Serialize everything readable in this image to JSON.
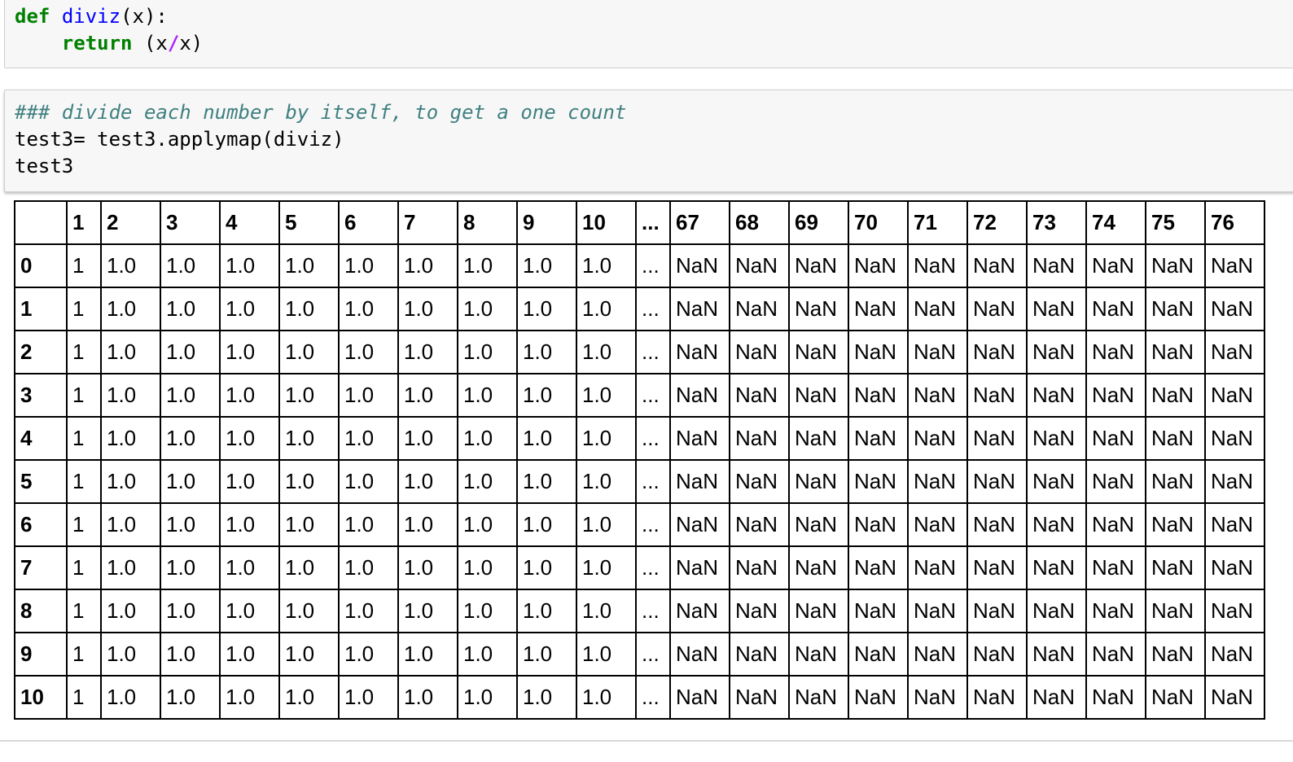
{
  "cells": [
    {
      "lines": [
        [
          {
            "t": "def",
            "c": "kw"
          },
          {
            "t": " "
          },
          {
            "t": "diviz",
            "c": "fn"
          },
          {
            "t": "(x):"
          }
        ],
        [
          {
            "t": "    "
          },
          {
            "t": "return",
            "c": "kw"
          },
          {
            "t": " (x"
          },
          {
            "t": "/",
            "c": "op"
          },
          {
            "t": "x)"
          }
        ]
      ]
    },
    {
      "lines": [
        [
          {
            "t": "### divide each number by itself, to get a one count",
            "c": "cm"
          }
        ],
        [
          {
            "t": "test3= test3.applymap(diviz)"
          }
        ],
        [
          {
            "t": "test3"
          }
        ]
      ]
    }
  ],
  "output": {
    "columns": [
      "",
      "1",
      "2",
      "3",
      "4",
      "5",
      "6",
      "7",
      "8",
      "9",
      "10",
      "...",
      "67",
      "68",
      "69",
      "70",
      "71",
      "72",
      "73",
      "74",
      "75",
      "76"
    ],
    "rows": [
      {
        "index": "0",
        "values": [
          "1",
          "1.0",
          "1.0",
          "1.0",
          "1.0",
          "1.0",
          "1.0",
          "1.0",
          "1.0",
          "1.0",
          "...",
          "NaN",
          "NaN",
          "NaN",
          "NaN",
          "NaN",
          "NaN",
          "NaN",
          "NaN",
          "NaN",
          "NaN"
        ]
      },
      {
        "index": "1",
        "values": [
          "1",
          "1.0",
          "1.0",
          "1.0",
          "1.0",
          "1.0",
          "1.0",
          "1.0",
          "1.0",
          "1.0",
          "...",
          "NaN",
          "NaN",
          "NaN",
          "NaN",
          "NaN",
          "NaN",
          "NaN",
          "NaN",
          "NaN",
          "NaN"
        ]
      },
      {
        "index": "2",
        "values": [
          "1",
          "1.0",
          "1.0",
          "1.0",
          "1.0",
          "1.0",
          "1.0",
          "1.0",
          "1.0",
          "1.0",
          "...",
          "NaN",
          "NaN",
          "NaN",
          "NaN",
          "NaN",
          "NaN",
          "NaN",
          "NaN",
          "NaN",
          "NaN"
        ]
      },
      {
        "index": "3",
        "values": [
          "1",
          "1.0",
          "1.0",
          "1.0",
          "1.0",
          "1.0",
          "1.0",
          "1.0",
          "1.0",
          "1.0",
          "...",
          "NaN",
          "NaN",
          "NaN",
          "NaN",
          "NaN",
          "NaN",
          "NaN",
          "NaN",
          "NaN",
          "NaN"
        ]
      },
      {
        "index": "4",
        "values": [
          "1",
          "1.0",
          "1.0",
          "1.0",
          "1.0",
          "1.0",
          "1.0",
          "1.0",
          "1.0",
          "1.0",
          "...",
          "NaN",
          "NaN",
          "NaN",
          "NaN",
          "NaN",
          "NaN",
          "NaN",
          "NaN",
          "NaN",
          "NaN"
        ]
      },
      {
        "index": "5",
        "values": [
          "1",
          "1.0",
          "1.0",
          "1.0",
          "1.0",
          "1.0",
          "1.0",
          "1.0",
          "1.0",
          "1.0",
          "...",
          "NaN",
          "NaN",
          "NaN",
          "NaN",
          "NaN",
          "NaN",
          "NaN",
          "NaN",
          "NaN",
          "NaN"
        ]
      },
      {
        "index": "6",
        "values": [
          "1",
          "1.0",
          "1.0",
          "1.0",
          "1.0",
          "1.0",
          "1.0",
          "1.0",
          "1.0",
          "1.0",
          "...",
          "NaN",
          "NaN",
          "NaN",
          "NaN",
          "NaN",
          "NaN",
          "NaN",
          "NaN",
          "NaN",
          "NaN"
        ]
      },
      {
        "index": "7",
        "values": [
          "1",
          "1.0",
          "1.0",
          "1.0",
          "1.0",
          "1.0",
          "1.0",
          "1.0",
          "1.0",
          "1.0",
          "...",
          "NaN",
          "NaN",
          "NaN",
          "NaN",
          "NaN",
          "NaN",
          "NaN",
          "NaN",
          "NaN",
          "NaN"
        ]
      },
      {
        "index": "8",
        "values": [
          "1",
          "1.0",
          "1.0",
          "1.0",
          "1.0",
          "1.0",
          "1.0",
          "1.0",
          "1.0",
          "1.0",
          "...",
          "NaN",
          "NaN",
          "NaN",
          "NaN",
          "NaN",
          "NaN",
          "NaN",
          "NaN",
          "NaN",
          "NaN"
        ]
      },
      {
        "index": "9",
        "values": [
          "1",
          "1.0",
          "1.0",
          "1.0",
          "1.0",
          "1.0",
          "1.0",
          "1.0",
          "1.0",
          "1.0",
          "...",
          "NaN",
          "NaN",
          "NaN",
          "NaN",
          "NaN",
          "NaN",
          "NaN",
          "NaN",
          "NaN",
          "NaN"
        ]
      },
      {
        "index": "10",
        "values": [
          "1",
          "1.0",
          "1.0",
          "1.0",
          "1.0",
          "1.0",
          "1.0",
          "1.0",
          "1.0",
          "1.0",
          "...",
          "NaN",
          "NaN",
          "NaN",
          "NaN",
          "NaN",
          "NaN",
          "NaN",
          "NaN",
          "NaN",
          "NaN"
        ]
      }
    ]
  }
}
